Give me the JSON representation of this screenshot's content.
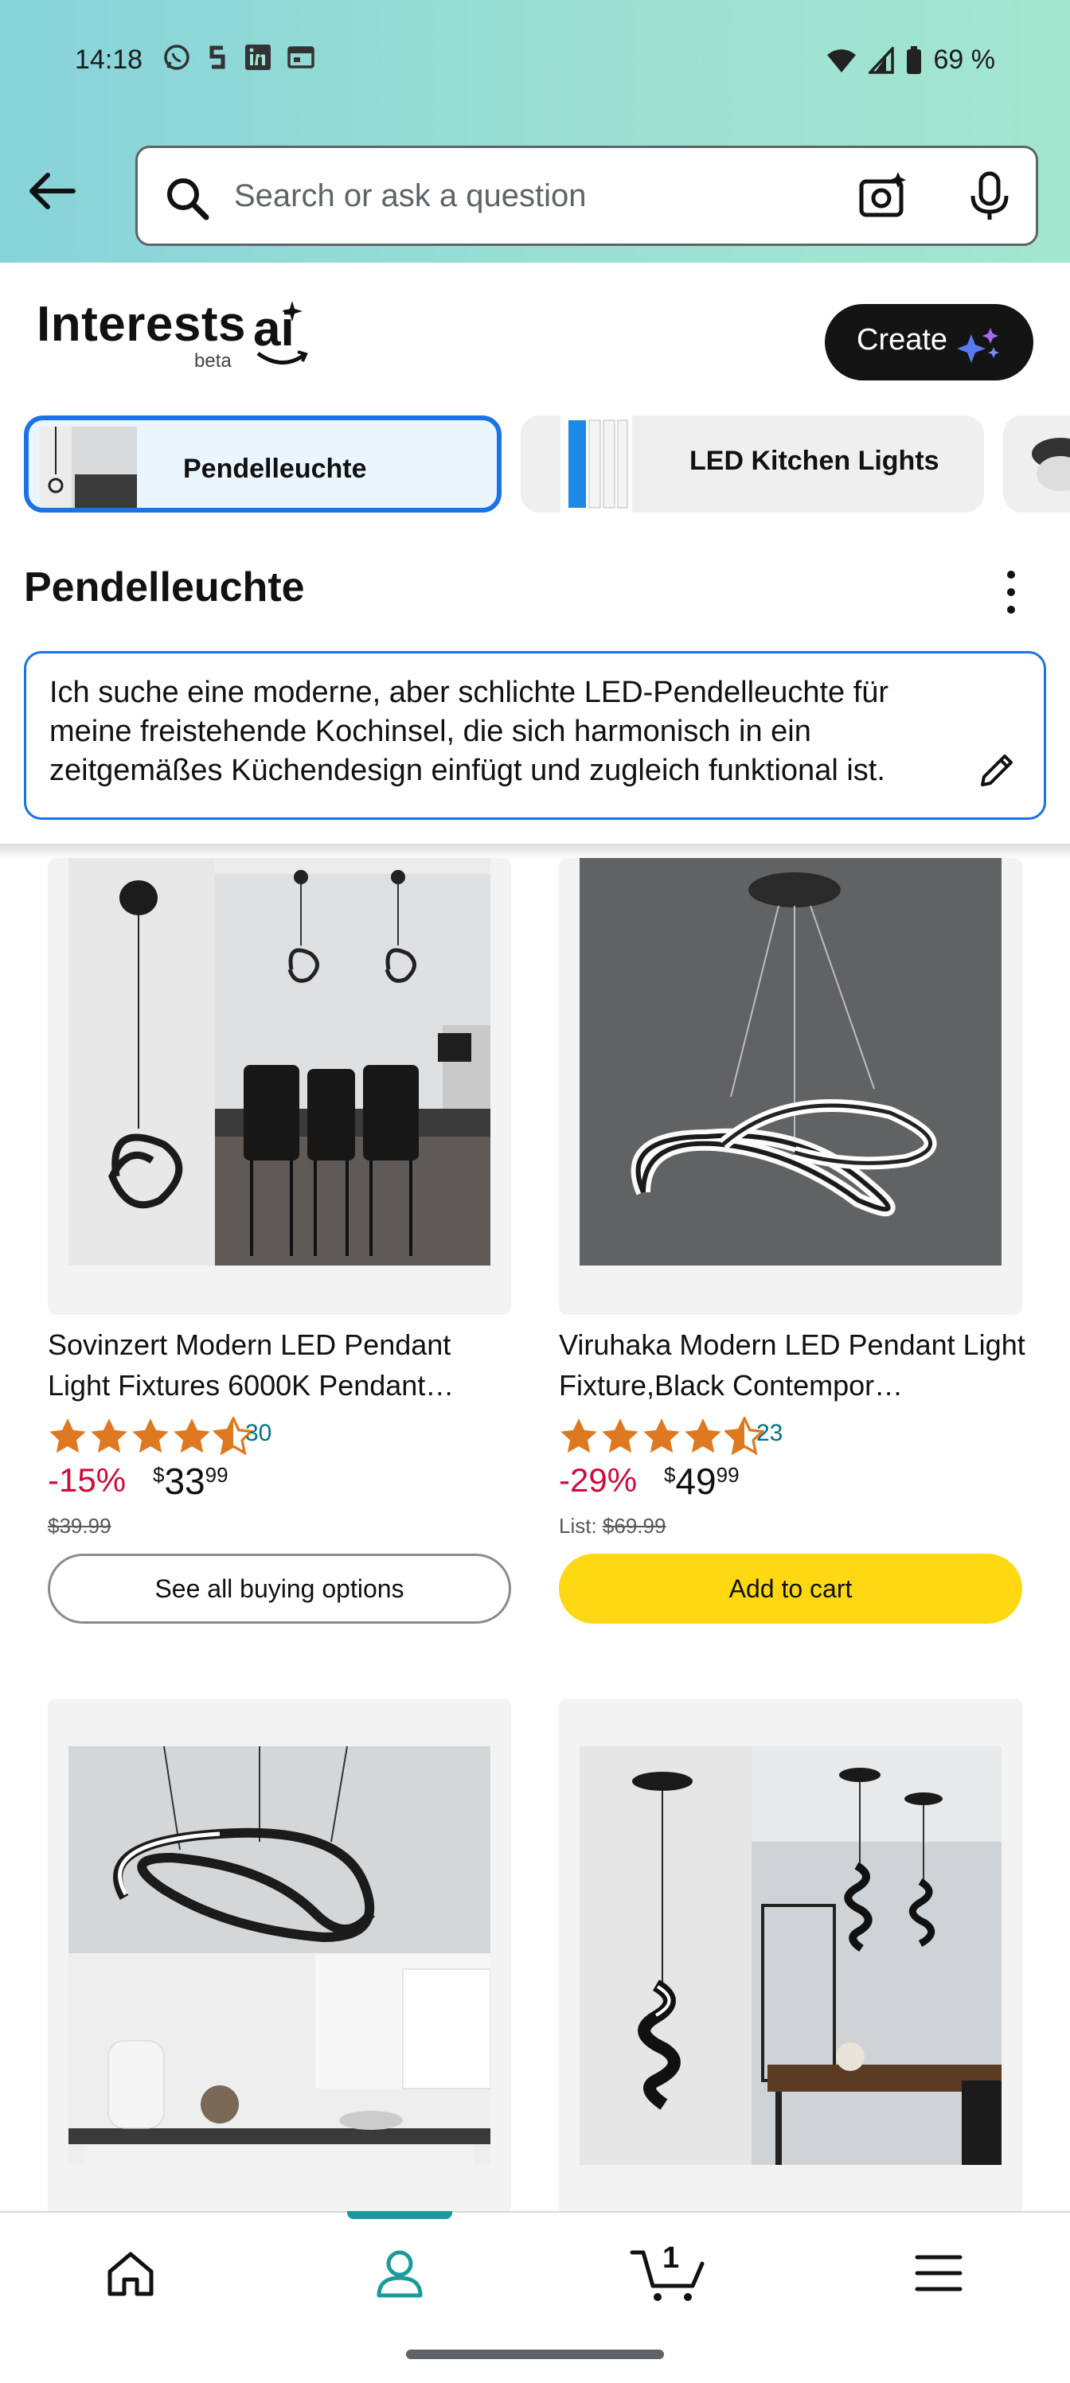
{
  "status_bar": {
    "time": "14:18",
    "battery": "69 %"
  },
  "search": {
    "placeholder": "Search or ask a question"
  },
  "header": {
    "title": "Interests",
    "ai_logo": "ai",
    "beta": "beta",
    "create_label": "Create"
  },
  "chips": [
    {
      "label": "Pendelleuchte",
      "selected": true
    },
    {
      "label": "LED Kitchen Lights",
      "selected": false
    },
    {
      "label": "",
      "selected": false
    }
  ],
  "section": {
    "title": "Pendelleuchte",
    "prompt": "Ich suche eine moderne, aber schlichte LED-Pendelleuchte für meine freistehende Kochinsel, die sich harmonisch in ein zeitgemäßes Küchendesign einfügt und zugleich funktional ist."
  },
  "products": [
    {
      "title": "Sovinzert Modern LED Pendant Light Fixtures 6000K Pendant…",
      "rating": 4.5,
      "rating_count": "30",
      "discount": "-15%",
      "price_symbol": "$",
      "price_whole": "33",
      "price_fraction": "99",
      "list_prefix": "",
      "list_price": "$39.99",
      "button": "See all buying options",
      "button_style": "outline"
    },
    {
      "title": "Viruhaka Modern LED Pendant Light Fixture,Black Contempor…",
      "rating": 4.5,
      "rating_count": "23",
      "discount": "-29%",
      "price_symbol": "$",
      "price_whole": "49",
      "price_fraction": "99",
      "list_prefix": "List: ",
      "list_price": "$69.99",
      "button": "Add to cart",
      "button_style": "yellow"
    }
  ],
  "bottom_nav": {
    "items": [
      "home-icon",
      "account-icon",
      "cart-icon",
      "menu-icon"
    ],
    "cart_count": "1",
    "active": "account-icon"
  },
  "colors": {
    "accent_blue": "#1a73e8",
    "deal_red": "#cc0c39",
    "star_orange": "#de7921",
    "cart_yellow": "#ffd814",
    "link_teal": "#007185"
  }
}
